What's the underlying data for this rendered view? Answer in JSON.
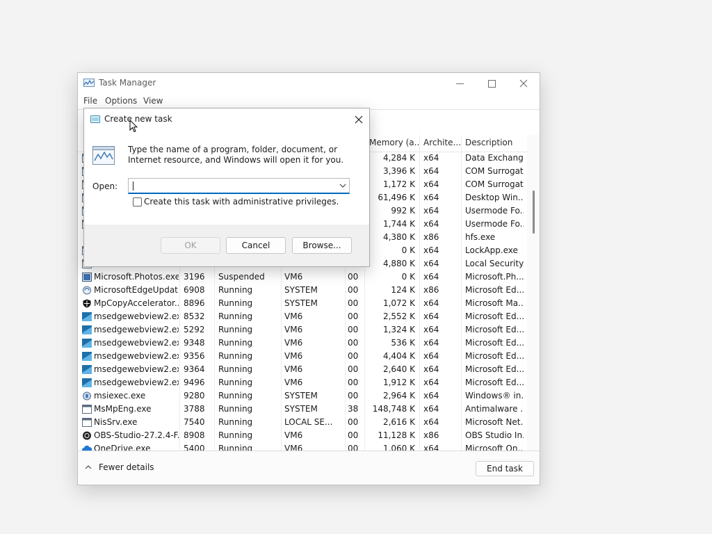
{
  "window": {
    "title": "Task Manager",
    "menu": [
      "File",
      "Options",
      "View"
    ]
  },
  "columns": {
    "memory": "Memory (a...",
    "architecture": "Archite...",
    "description": "Description"
  },
  "rows": [
    {
      "name": "",
      "pid": "",
      "status": "",
      "user": "",
      "cpu": "",
      "memory": "4,284 K",
      "arch": "x64",
      "description": "Data Exchang...",
      "icon": "generic-app-icon"
    },
    {
      "name": "",
      "pid": "",
      "status": "",
      "user": "",
      "cpu": "",
      "memory": "3,396 K",
      "arch": "x64",
      "description": "COM Surrogate",
      "icon": "generic-app-icon"
    },
    {
      "name": "",
      "pid": "",
      "status": "",
      "user": "",
      "cpu": "",
      "memory": "1,172 K",
      "arch": "x64",
      "description": "COM Surrogate",
      "icon": "generic-app-icon"
    },
    {
      "name": "",
      "pid": "",
      "status": "",
      "user": "",
      "cpu": "",
      "memory": "61,496 K",
      "arch": "x64",
      "description": "Desktop Win...",
      "icon": "generic-app-icon"
    },
    {
      "name": "",
      "pid": "",
      "status": "",
      "user": "",
      "cpu": "",
      "memory": "992 K",
      "arch": "x64",
      "description": "Usermode Fo...",
      "icon": "generic-app-icon"
    },
    {
      "name": "",
      "pid": "",
      "status": "",
      "user": "",
      "cpu": "",
      "memory": "1,744 K",
      "arch": "x64",
      "description": "Usermode Fo...",
      "icon": "generic-app-icon"
    },
    {
      "name": "",
      "pid": "",
      "status": "",
      "user": "",
      "cpu": "",
      "memory": "4,380 K",
      "arch": "x86",
      "description": "hfs.exe",
      "icon": "lock-icon"
    },
    {
      "name": "",
      "pid": "",
      "status": "",
      "user": "",
      "cpu": "",
      "memory": "0 K",
      "arch": "x64",
      "description": "LockApp.exe",
      "icon": "generic-app-icon"
    },
    {
      "name": "",
      "pid": "",
      "status": "",
      "user": "",
      "cpu": "",
      "memory": "4,880 K",
      "arch": "x64",
      "description": "Local Security...",
      "icon": "generic-app-icon"
    },
    {
      "name": "Microsoft.Photos.exe",
      "pid": "3196",
      "status": "Suspended",
      "user": "VM6",
      "cpu": "00",
      "memory": "0 K",
      "arch": "x64",
      "description": "Microsoft.Ph...",
      "icon": "photos-icon"
    },
    {
      "name": "MicrosoftEdgeUpdat...",
      "pid": "6908",
      "status": "Running",
      "user": "SYSTEM",
      "cpu": "00",
      "memory": "124 K",
      "arch": "x86",
      "description": "Microsoft Ed...",
      "icon": "update-icon"
    },
    {
      "name": "MpCopyAccelerator....",
      "pid": "8896",
      "status": "Running",
      "user": "SYSTEM",
      "cpu": "00",
      "memory": "1,072 K",
      "arch": "x64",
      "description": "Microsoft Ma...",
      "icon": "shield-icon"
    },
    {
      "name": "msedgewebview2.exe",
      "pid": "8532",
      "status": "Running",
      "user": "VM6",
      "cpu": "00",
      "memory": "2,552 K",
      "arch": "x64",
      "description": "Microsoft Ed...",
      "icon": "webview-icon"
    },
    {
      "name": "msedgewebview2.exe",
      "pid": "5292",
      "status": "Running",
      "user": "VM6",
      "cpu": "00",
      "memory": "1,324 K",
      "arch": "x64",
      "description": "Microsoft Ed...",
      "icon": "webview-icon"
    },
    {
      "name": "msedgewebview2.exe",
      "pid": "9348",
      "status": "Running",
      "user": "VM6",
      "cpu": "00",
      "memory": "536 K",
      "arch": "x64",
      "description": "Microsoft Ed...",
      "icon": "webview-icon"
    },
    {
      "name": "msedgewebview2.exe",
      "pid": "9356",
      "status": "Running",
      "user": "VM6",
      "cpu": "00",
      "memory": "4,404 K",
      "arch": "x64",
      "description": "Microsoft Ed...",
      "icon": "webview-icon"
    },
    {
      "name": "msedgewebview2.exe",
      "pid": "9364",
      "status": "Running",
      "user": "VM6",
      "cpu": "00",
      "memory": "2,640 K",
      "arch": "x64",
      "description": "Microsoft Ed...",
      "icon": "webview-icon"
    },
    {
      "name": "msedgewebview2.exe",
      "pid": "9496",
      "status": "Running",
      "user": "VM6",
      "cpu": "00",
      "memory": "1,912 K",
      "arch": "x64",
      "description": "Microsoft Ed...",
      "icon": "webview-icon"
    },
    {
      "name": "msiexec.exe",
      "pid": "9280",
      "status": "Running",
      "user": "SYSTEM",
      "cpu": "00",
      "memory": "2,964 K",
      "arch": "x64",
      "description": "Windows® in...",
      "icon": "installer-icon"
    },
    {
      "name": "MsMpEng.exe",
      "pid": "3788",
      "status": "Running",
      "user": "SYSTEM",
      "cpu": "38",
      "memory": "148,748 K",
      "arch": "x64",
      "description": "Antimalware ...",
      "icon": "generic-app-icon"
    },
    {
      "name": "NisSrv.exe",
      "pid": "7540",
      "status": "Running",
      "user": "LOCAL SE...",
      "cpu": "00",
      "memory": "2,616 K",
      "arch": "x64",
      "description": "Microsoft Net...",
      "icon": "generic-app-icon"
    },
    {
      "name": "OBS-Studio-27.2.4-F...",
      "pid": "8908",
      "status": "Running",
      "user": "VM6",
      "cpu": "00",
      "memory": "11,128 K",
      "arch": "x86",
      "description": "OBS Studio In...",
      "icon": "obs-icon"
    },
    {
      "name": "OneDrive.exe",
      "pid": "5400",
      "status": "Running",
      "user": "VM6",
      "cpu": "00",
      "memory": "1,060 K",
      "arch": "x64",
      "description": "Microsoft On...",
      "icon": "cloud-icon"
    }
  ],
  "footer": {
    "fewer_details": "Fewer details",
    "end_task": "End task"
  },
  "dialog": {
    "title": "Create new task",
    "description": "Type the name of a program, folder, document, or Internet resource, and Windows will open it for you.",
    "open_label": "Open:",
    "open_value": "",
    "admin_checkbox_label": "Create this task with administrative privileges.",
    "admin_checked": false,
    "ok_label": "OK",
    "cancel_label": "Cancel",
    "browse_label": "Browse..."
  },
  "colors": {
    "accent": "#0067c0",
    "webview_icon": "#1e6fa8"
  }
}
